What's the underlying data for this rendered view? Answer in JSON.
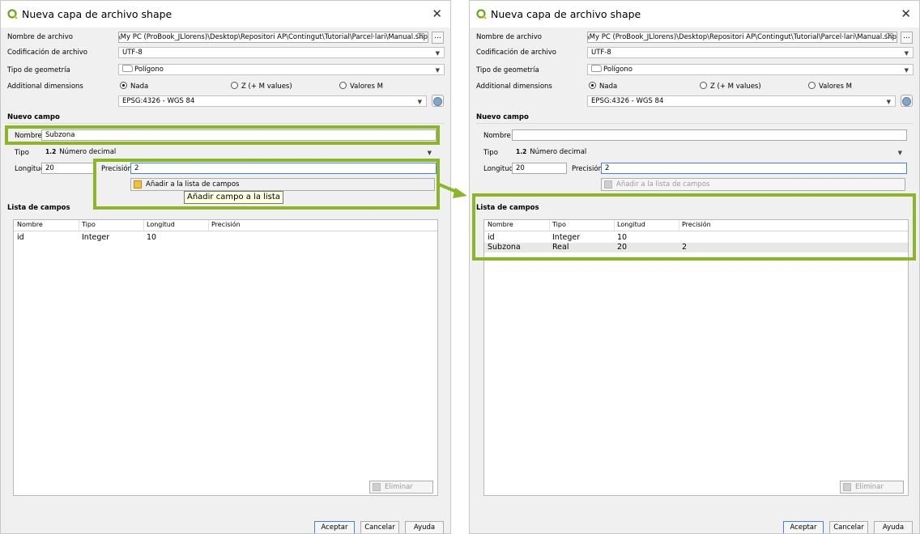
{
  "dialog": {
    "title": "Nueva capa de archivo shape",
    "labels": {
      "filename": "Nombre de archivo",
      "encoding": "Codificación de archivo",
      "geometry_type": "Tipo de geometría",
      "additional_dimensions": "Additional dimensions",
      "new_field": "Nuevo campo",
      "name": "Nombre",
      "type": "Tipo",
      "length": "Longitud",
      "precision": "Precisión",
      "field_list": "Lista de campos"
    },
    "filename_value": "Dropbox\\My PC (ProBook_JLlorens)\\Desktop\\Repositori AP\\Contingut\\Tutorial\\Parcel·lari\\Manual.shp",
    "browse_label": "...",
    "encoding_value": "UTF-8",
    "geometry_value": "Polígono",
    "dimensions": [
      "Nada",
      "Z (+ M values)",
      "Valores M"
    ],
    "crs_value": "EPSG:4326 - WGS 84",
    "type_prefix": "1.2",
    "type_value": "Número decimal",
    "add_button": "Añadir a la lista de campos",
    "table_headers": [
      "Nombre",
      "Tipo",
      "Longitud",
      "Precisión"
    ],
    "remove_button": "Eliminar campo",
    "footer_buttons": {
      "ok": "Aceptar",
      "cancel": "Cancelar",
      "help": "Ayuda"
    }
  },
  "left": {
    "name_value": "Subzona",
    "length_value": "20",
    "precision_value": "2",
    "tooltip": "Añadir campo a la lista",
    "rows": [
      {
        "name": "id",
        "type": "Integer",
        "length": "10",
        "precision": ""
      }
    ]
  },
  "right": {
    "name_value": "",
    "length_value": "20",
    "precision_value": "2",
    "rows": [
      {
        "name": "id",
        "type": "Integer",
        "length": "10",
        "precision": ""
      },
      {
        "name": "Subzona",
        "type": "Real",
        "length": "20",
        "precision": "2"
      }
    ]
  },
  "colors": {
    "highlight": "#8ab628",
    "focus": "#3f86d6"
  }
}
